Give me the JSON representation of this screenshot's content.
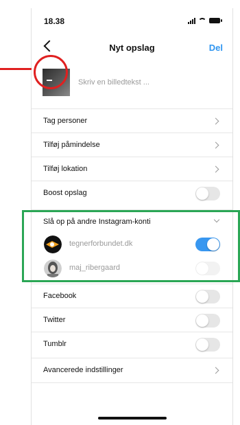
{
  "status_bar": {
    "time": "18.38"
  },
  "nav": {
    "title": "Nyt opslag",
    "action": "Del"
  },
  "caption": {
    "placeholder": "Skriv en billedtekst ..."
  },
  "rows": {
    "tag_people": "Tag personer",
    "reminder": "Tilføj påmindelse",
    "location": "Tilføj lokation",
    "boost": "Boost opslag",
    "cross_post": "Slå op på andre Instagram-konti",
    "facebook": "Facebook",
    "twitter": "Twitter",
    "tumblr": "Tumblr",
    "advanced": "Avancerede indstillinger"
  },
  "accounts": [
    {
      "name": "tegnerforbundet.dk",
      "enabled": true
    },
    {
      "name": "maj_ribergaard",
      "enabled": false
    }
  ],
  "toggles": {
    "boost": false,
    "facebook": false,
    "twitter": false,
    "tumblr": false
  },
  "colors": {
    "accent": "#3897f0",
    "annotation_red": "#e02020",
    "annotation_green": "#2aa655"
  }
}
